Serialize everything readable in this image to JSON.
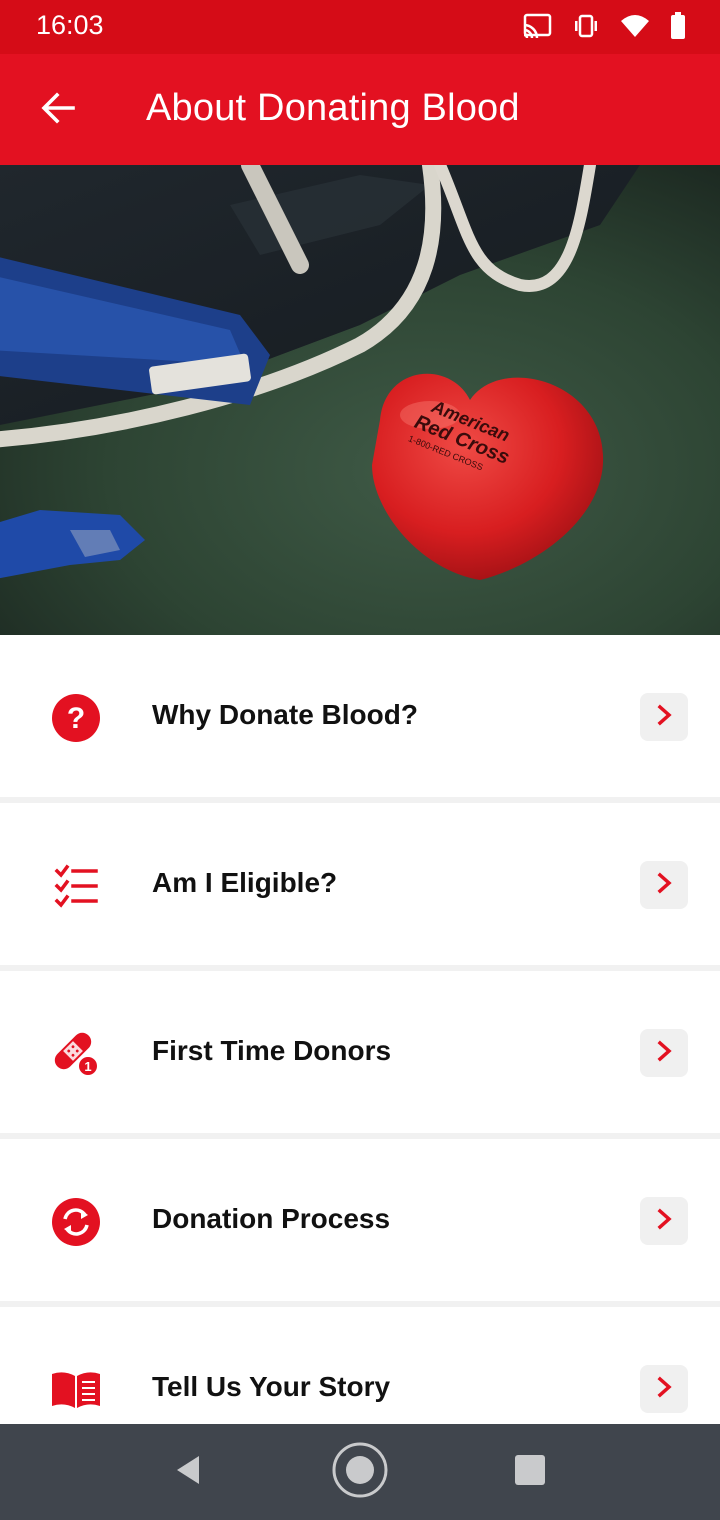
{
  "status_bar": {
    "time": "16:03",
    "icons": [
      "cast-icon",
      "vibrate-icon",
      "wifi-icon",
      "battery-icon"
    ]
  },
  "app_bar": {
    "title": "About Donating Blood",
    "back_icon": "arrow-back-icon"
  },
  "hero_image": {
    "description_icon": "heart-stress-ball-photo",
    "logo_text_line1": "American",
    "logo_text_line2": "Red Cross",
    "logo_text_line3": "1-800-RED CROSS"
  },
  "menu": {
    "items": [
      {
        "label": "Why Donate Blood?",
        "icon": "question-circle-icon"
      },
      {
        "label": "Am I Eligible?",
        "icon": "checklist-icon"
      },
      {
        "label": "First Time Donors",
        "icon": "bandage-icon"
      },
      {
        "label": "Donation Process",
        "icon": "sync-circle-icon"
      },
      {
        "label": "Tell Us Your Story",
        "icon": "open-book-icon"
      }
    ]
  },
  "colors": {
    "brand_red": "#e31121",
    "status_red": "#d50c17",
    "nav_bar": "#40454d"
  }
}
